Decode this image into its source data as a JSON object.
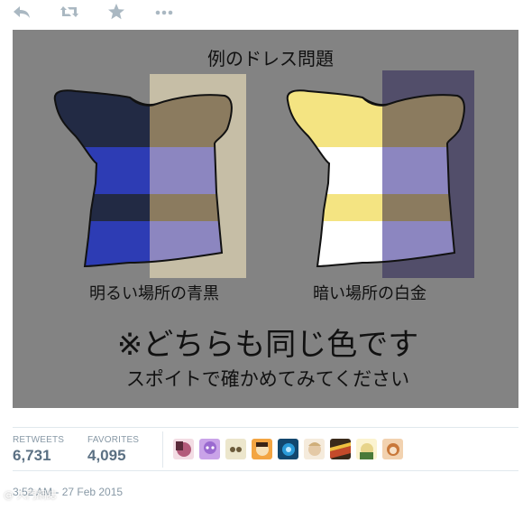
{
  "toolbar": {
    "icons": [
      "reply-icon",
      "retweet-icon",
      "favorite-icon",
      "more-icon"
    ],
    "icon_color": "#aab8c2"
  },
  "image": {
    "title": "例のドレス問題",
    "left_caption": "明るい場所の青黒",
    "right_caption": "暗い場所の白金",
    "main_text": "※どちらも同じ色です",
    "sub_text": "スポイトで確かめてみてください",
    "colors": {
      "background": "#838383",
      "dark_navy": "#222a44",
      "royal_blue": "#2d3cb4",
      "beige_overlay": "#c6bea6",
      "brown_stripe": "#8b7b5f",
      "lavender_stripe": "#8c86c0",
      "yellow_stripe": "#f4e482",
      "white_stripe": "#ffffff",
      "dark_overlay": "#524e6a"
    }
  },
  "stats": {
    "retweets_label": "RETWEETS",
    "retweets_value": "6,731",
    "favorites_label": "FAVORITES",
    "favorites_value": "4,095"
  },
  "avatars": [
    {
      "name": "avatar-1",
      "color": "#b35a7a"
    },
    {
      "name": "avatar-2",
      "color": "#9a6ad0"
    },
    {
      "name": "avatar-3",
      "color": "#cfc7a3"
    },
    {
      "name": "avatar-4",
      "color": "#d98a2e"
    },
    {
      "name": "avatar-5",
      "color": "#2a7fb8"
    },
    {
      "name": "avatar-6",
      "color": "#e4c9a6"
    },
    {
      "name": "avatar-7",
      "color": "#c44a2a"
    },
    {
      "name": "avatar-8",
      "color": "#e7d48a"
    },
    {
      "name": "avatar-9",
      "color": "#c9783a"
    }
  ],
  "timestamp": "3:52 AM - 27 Feb 2015",
  "watermark": "@ 入門網誌"
}
